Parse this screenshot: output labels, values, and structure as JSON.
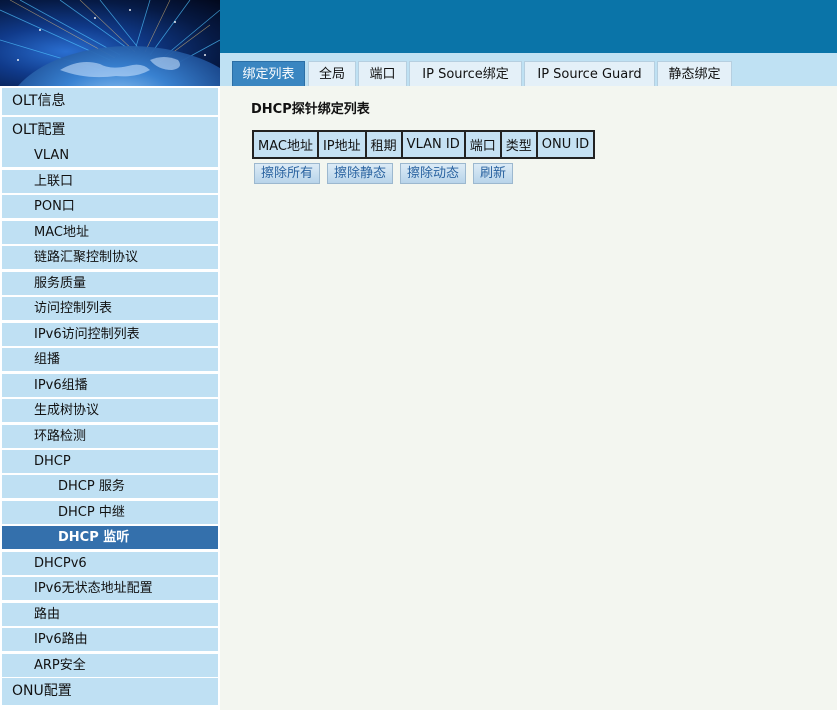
{
  "tabs": [
    {
      "label": "绑定列表",
      "active": true
    },
    {
      "label": "全局",
      "active": false
    },
    {
      "label": "端口",
      "active": false
    },
    {
      "label": "IP Source绑定",
      "active": false
    },
    {
      "label": "IP Source Guard",
      "active": false
    },
    {
      "label": "静态绑定",
      "active": false
    }
  ],
  "main": {
    "section_title": "DHCP探针绑定列表",
    "table_headers": [
      "MAC地址",
      "IP地址",
      "租期",
      "VLAN ID",
      "端口",
      "类型",
      "ONU ID"
    ],
    "buttons": {
      "clear_all": "擦除所有",
      "clear_static": "擦除静态",
      "clear_dynamic": "擦除动态",
      "refresh": "刷新"
    }
  },
  "sidebar": {
    "items": [
      {
        "label": "OLT信息",
        "level": 1
      },
      {
        "label": "OLT配置",
        "level": 1
      },
      {
        "label": "VLAN",
        "level": 2
      },
      {
        "label": "上联口",
        "level": 2
      },
      {
        "label": "PON口",
        "level": 2
      },
      {
        "label": "MAC地址",
        "level": 2
      },
      {
        "label": "链路汇聚控制协议",
        "level": 2
      },
      {
        "label": "服务质量",
        "level": 2
      },
      {
        "label": "访问控制列表",
        "level": 2
      },
      {
        "label": "IPv6访问控制列表",
        "level": 2
      },
      {
        "label": "组播",
        "level": 2
      },
      {
        "label": "IPv6组播",
        "level": 2
      },
      {
        "label": "生成树协议",
        "level": 2
      },
      {
        "label": "环路检测",
        "level": 2
      },
      {
        "label": "DHCP",
        "level": 2
      },
      {
        "label": "DHCP 服务",
        "level": 3
      },
      {
        "label": "DHCP 中继",
        "level": 3
      },
      {
        "label": "DHCP 监听",
        "level": 3,
        "active": true
      },
      {
        "label": "DHCPv6",
        "level": 2
      },
      {
        "label": "IPv6无状态地址配置",
        "level": 2
      },
      {
        "label": "路由",
        "level": 2
      },
      {
        "label": "IPv6路由",
        "level": 2
      },
      {
        "label": "ARP安全",
        "level": 2
      },
      {
        "label": "ONU配置",
        "level": 1
      }
    ]
  },
  "colors": {
    "header": "#0a74a8",
    "tabbar": "#bfe1f3",
    "active_tab": "#3a86c1",
    "sidebar_item": "#bfe0f3",
    "sidebar_active": "#3470ac",
    "content_bg": "#f3f6f0"
  }
}
